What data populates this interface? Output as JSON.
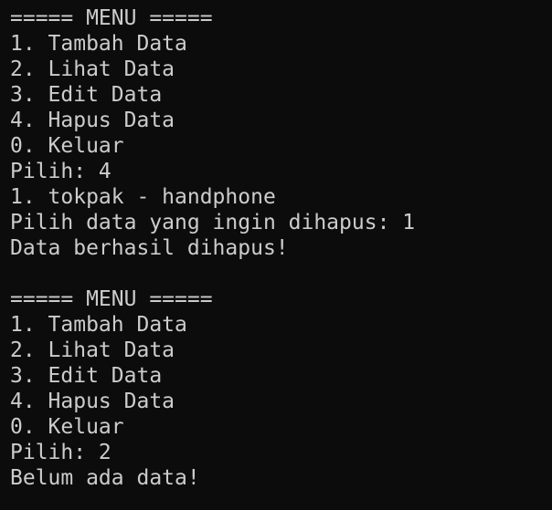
{
  "terminal": {
    "lines": [
      "===== MENU =====",
      "1. Tambah Data",
      "2. Lihat Data",
      "3. Edit Data",
      "4. Hapus Data",
      "0. Keluar",
      "Pilih: 4",
      "1. tokpak - handphone",
      "Pilih data yang ingin dihapus: 1",
      "Data berhasil dihapus!",
      "",
      "===== MENU =====",
      "1. Tambah Data",
      "2. Lihat Data",
      "3. Edit Data",
      "4. Hapus Data",
      "0. Keluar",
      "Pilih: 2",
      "Belum ada data!"
    ]
  },
  "colors": {
    "background": "#0c0c0c",
    "text": "#cccccc"
  }
}
